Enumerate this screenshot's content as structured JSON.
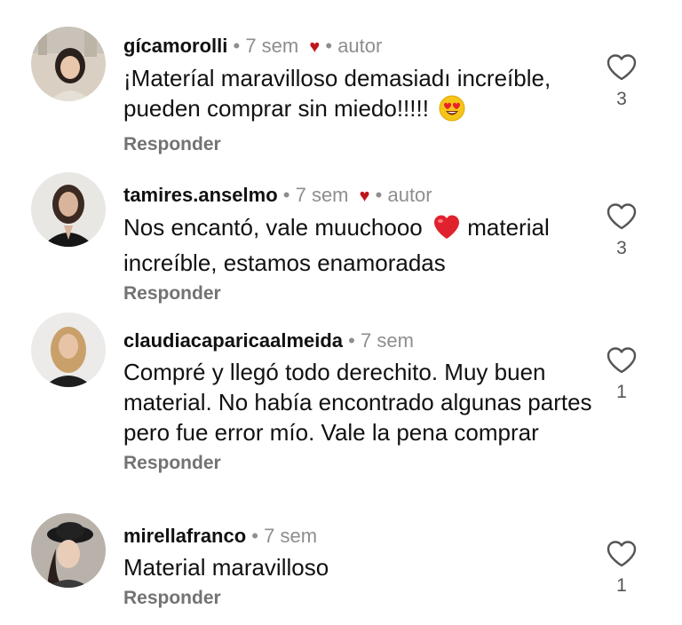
{
  "comments": [
    {
      "username": "gícamorolli",
      "time": "7 sem",
      "author_badge": "autor",
      "text": "¡Materíal maravilloso demasiadı increíble, pueden comprar sin miedo!!!!!",
      "emoji": "smiling-face-heart-eyes",
      "reply_label": "Responder",
      "likes": "3"
    },
    {
      "username": "tamires.anselmo",
      "time": "7 sem",
      "author_badge": "autor",
      "text_before": "Nos encantó, vale muuchooo",
      "text_after": "material increíble, estamos enamoradas",
      "emoji": "red-heart",
      "reply_label": "Responder",
      "likes": "3"
    },
    {
      "username": "claudiacaparicaalmeida",
      "time": "7 sem",
      "text": "Compré y llegó todo derechito.  Muy buen material. No había encontrado algunas partes pero fue error mío. Vale la pena comprar",
      "reply_label": "Responder",
      "likes": "1"
    },
    {
      "username": "mirellafranco",
      "time": "7 sem",
      "text": "Material maravilloso",
      "reply_label": "Responder",
      "likes": "1"
    }
  ],
  "separator": "•",
  "colors": {
    "text": "#111111",
    "muted": "#8e8e8e",
    "heart_red": "#c0141c"
  }
}
